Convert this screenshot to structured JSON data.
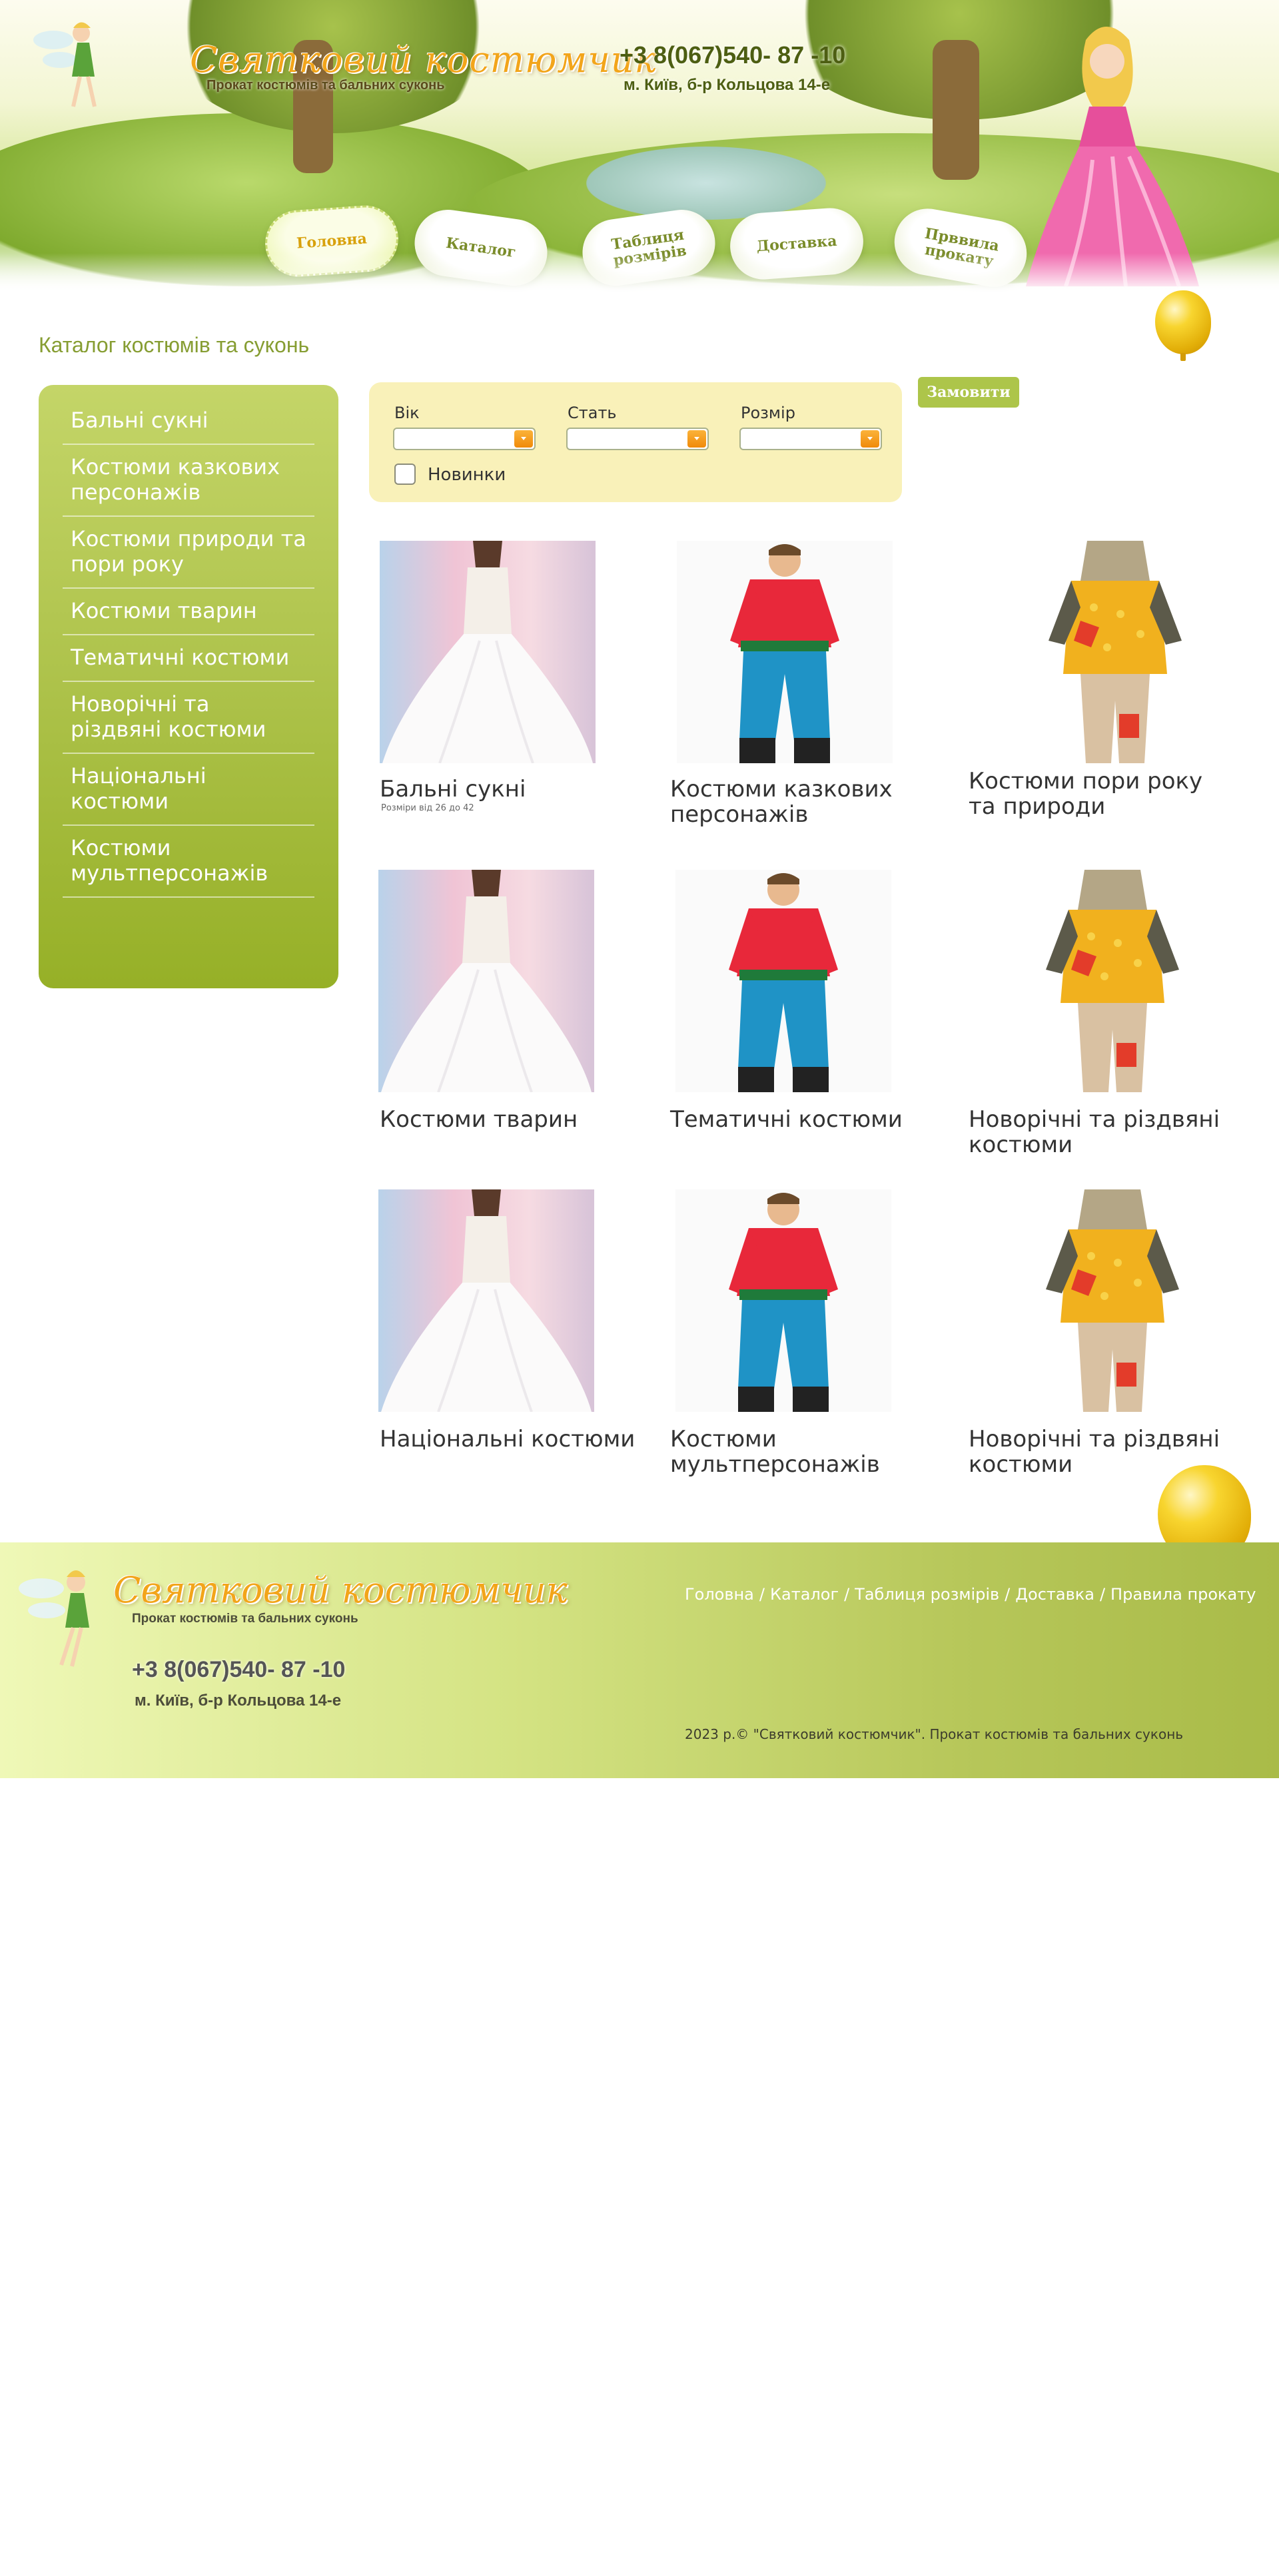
{
  "header": {
    "logo_title": "Святковий костюмчик",
    "logo_subtitle": "Прокат костюмів та бальних суконь",
    "phone": "+3 8(067)540- 87 -10",
    "address": "м. Київ, б-р Кольцова 14-е",
    "nav": [
      {
        "label_lines": [
          "Головна"
        ],
        "active": true
      },
      {
        "label_lines": [
          "Каталог"
        ],
        "active": false
      },
      {
        "label_lines": [
          "Таблиця",
          "розмірів"
        ],
        "active": false
      },
      {
        "label_lines": [
          "Доставка"
        ],
        "active": false
      },
      {
        "label_lines": [
          "Прввила",
          "прокату"
        ],
        "active": false
      }
    ]
  },
  "page_title": "Каталог костюмів та суконь",
  "sidebar": {
    "items": [
      {
        "label": "Бальні сукні"
      },
      {
        "label": "Костюми казкових персонажів"
      },
      {
        "label": "Костюми природи та пори року"
      },
      {
        "label": "Костюми тварин"
      },
      {
        "label": "Тематичні костюми"
      },
      {
        "label": "Новорічні та різдвяні костюми"
      },
      {
        "label": "Національні костюми"
      },
      {
        "label": "Костюми мультперсонажів"
      }
    ]
  },
  "filter": {
    "age_label": "Вік",
    "gender_label": "Стать",
    "size_label": "Розмір",
    "age_value": "",
    "gender_value": "",
    "size_value": "",
    "new_label": "Новинки",
    "new_checked": false
  },
  "order_button": "Замовити",
  "products": [
    {
      "name": "Бальні сукні",
      "sizes": "Розміри від 26 до 42",
      "photo": "dress-photo"
    },
    {
      "name": "Костюми казкових персонажів",
      "sizes": "",
      "photo": "boy-costume-photo"
    },
    {
      "name": "Костюми пори року та природи",
      "sizes": "",
      "photo": "scarecrow-costume-photo"
    },
    {
      "name": "Костюми тварин",
      "sizes": "",
      "photo": "dress-photo"
    },
    {
      "name": "Тематичні костюми",
      "sizes": "",
      "photo": "boy-costume-photo"
    },
    {
      "name": "Новорічні та різдвяні костюми",
      "sizes": "",
      "photo": "scarecrow-costume-photo"
    },
    {
      "name": "Національні костюми",
      "sizes": "",
      "photo": "dress-photo"
    },
    {
      "name": "Костюми мультперсонажів",
      "sizes": "",
      "photo": "boy-costume-photo"
    },
    {
      "name": "Новорічні та різдвяні костюми",
      "sizes": "",
      "photo": "scarecrow-costume-photo"
    }
  ],
  "footer": {
    "logo_title": "Святковий костюмчик",
    "logo_subtitle": "Прокат костюмів та бальних суконь",
    "phone": "+3 8(067)540- 87 -10",
    "address": "м. Київ, б-р Кольцова 14-е",
    "nav": [
      "Головна",
      "Каталог",
      "Таблиця розмірів",
      "Доставка",
      "Правила прокату"
    ],
    "separator": "/",
    "copyright": "2023 р.© \"Святковий костюмчик\". Прокат костюмів та бальних суконь"
  },
  "colors": {
    "accent_green": "#adc54a",
    "title_green": "#869d32",
    "logo_orange": "#f2a51a",
    "filter_bg": "#f9f1b9"
  }
}
